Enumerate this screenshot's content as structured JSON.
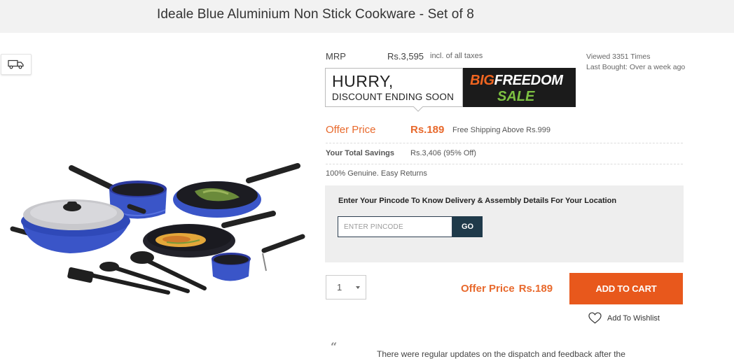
{
  "product": {
    "title": "Ideale Blue Aluminium Non Stick Cookware - Set of 8"
  },
  "icons": {
    "delivery": "truck-icon",
    "wishlist": "heart-icon",
    "dropdown": "caret-down-icon",
    "quote": "quote-icon"
  },
  "pricing": {
    "mrp_label": "MRP",
    "mrp_value": "Rs.3,595",
    "tax_note": "incl. of all taxes",
    "offer_label": "Offer Price",
    "offer_value": "Rs.189",
    "shipping_note": "Free Shipping Above Rs.999",
    "savings_label": "Your Total Savings",
    "savings_value": "Rs.3,406 (95% Off)",
    "genuine_note": "100% Genuine. Easy Returns"
  },
  "stats": {
    "viewed": "Viewed 3351 Times",
    "last_bought": "Last Bought: Over a week ago"
  },
  "banner": {
    "line1": "HURRY,",
    "line2": "DISCOUNT ENDING SOON",
    "big": "BIG",
    "freedom": "FREEDOM",
    "sale": "SALE"
  },
  "pincode": {
    "heading": "Enter Your Pincode To Know Delivery & Assembly Details For Your Location",
    "placeholder": "ENTER PINCODE",
    "button": "GO"
  },
  "cart": {
    "quantity": "1",
    "offer_label": "Offer Price",
    "offer_value": "Rs.189",
    "add_button": "ADD TO CART",
    "wishlist_label": "Add To Wishlist"
  },
  "review": {
    "quote_mark": "“",
    "text": "There were regular updates on the dispatch and feedback after the"
  },
  "colors": {
    "accent_orange": "#e8581c",
    "price_orange": "#e8692c",
    "dark_navy": "#1f3a4a",
    "cookware_blue": "#3a55c8",
    "sale_green": "#7dc142"
  }
}
